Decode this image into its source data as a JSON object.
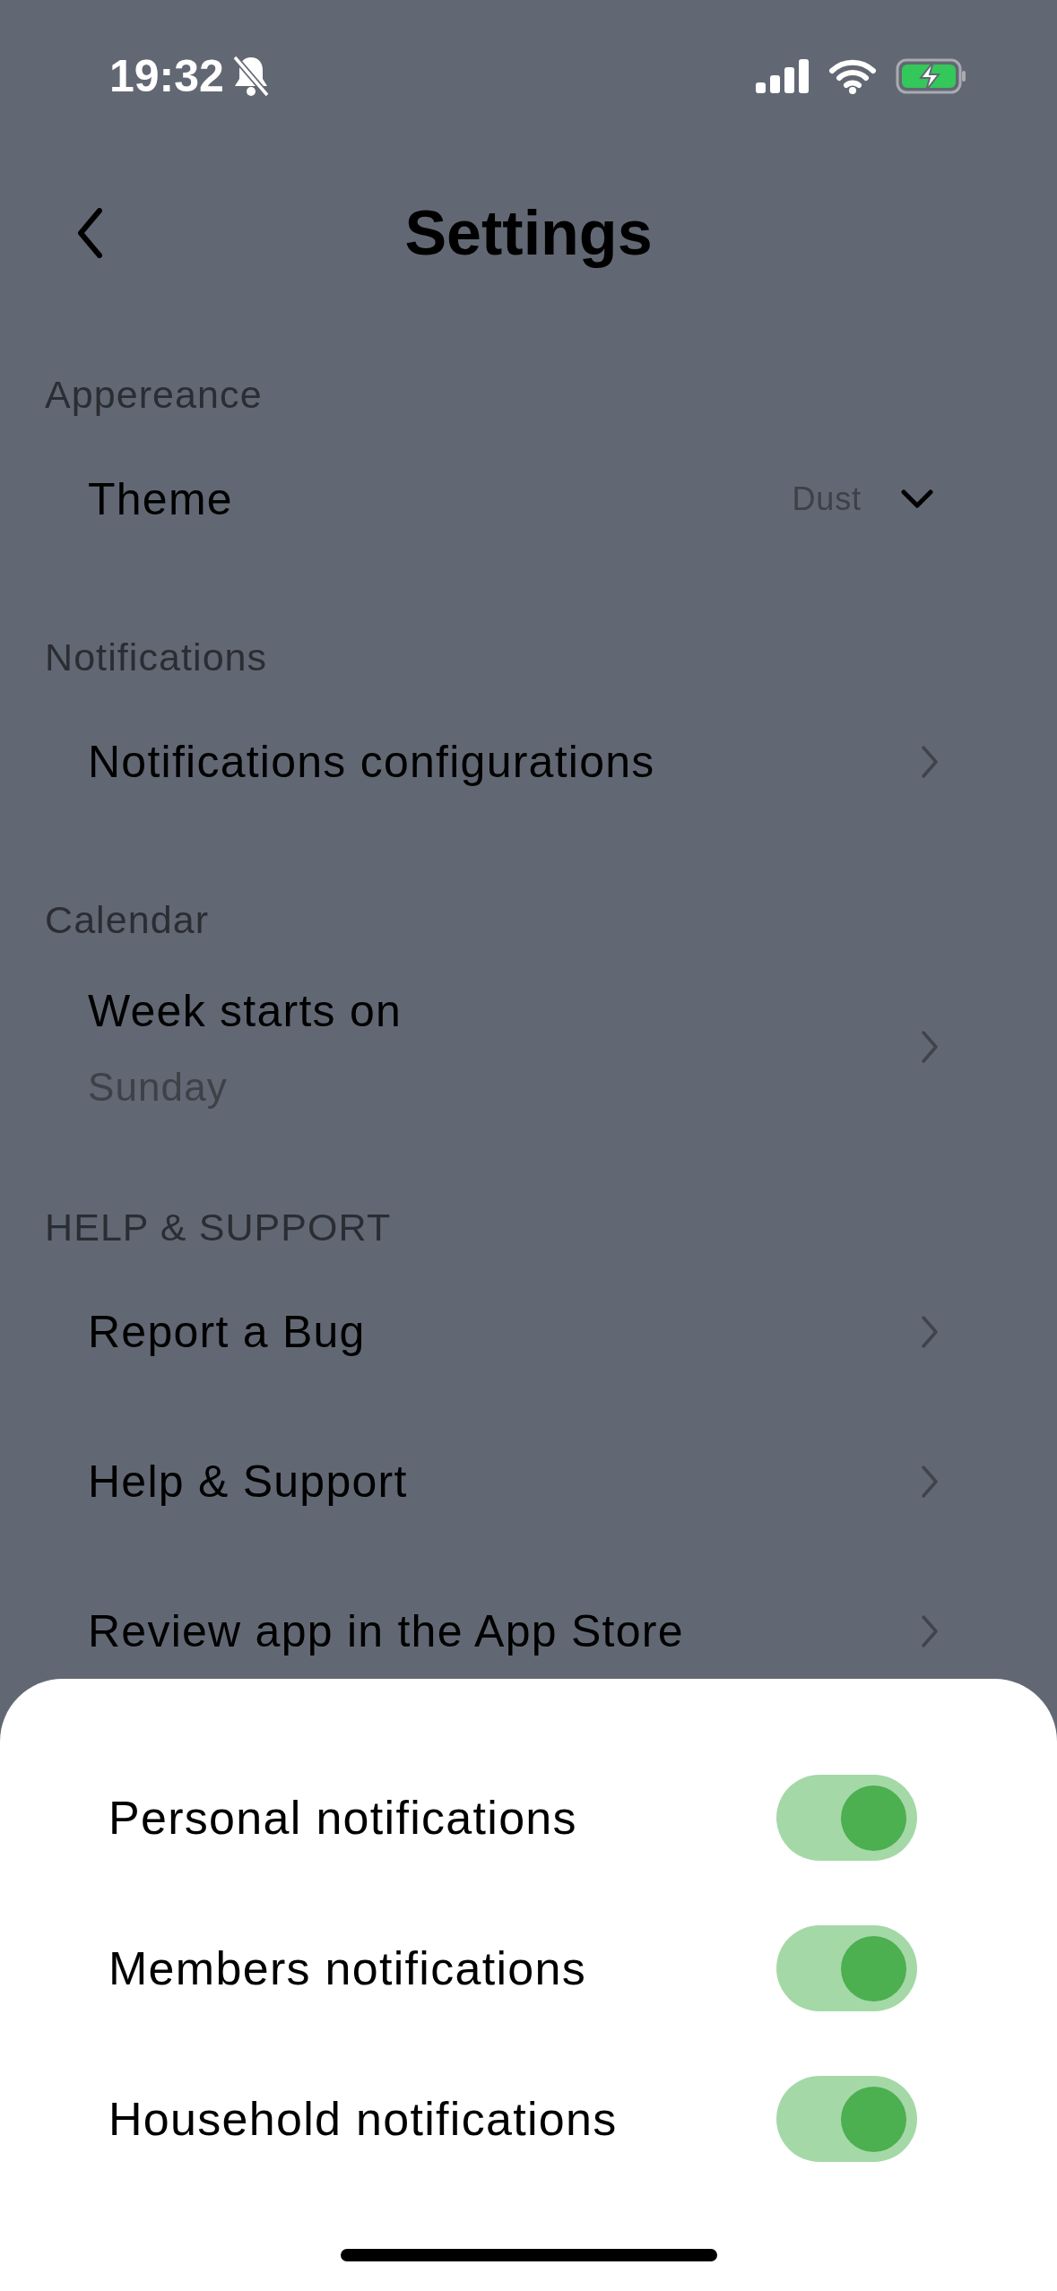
{
  "status_bar": {
    "time": "19:32"
  },
  "header": {
    "title": "Settings"
  },
  "sections": [
    {
      "title": "Appereance",
      "items": [
        {
          "kind": "dropdown",
          "label": "Theme",
          "value": "Dust"
        }
      ]
    },
    {
      "title": "Notifications",
      "items": [
        {
          "kind": "link",
          "label": "Notifications configurations"
        }
      ]
    },
    {
      "title": "Calendar",
      "items": [
        {
          "kind": "link",
          "label": "Week starts on",
          "subtitle": "Sunday"
        }
      ]
    },
    {
      "title": "HELP & SUPPORT",
      "items": [
        {
          "kind": "link",
          "label": "Report a Bug"
        },
        {
          "kind": "link",
          "label": "Help & Support"
        },
        {
          "kind": "link",
          "label": "Review app in the App Store"
        }
      ]
    }
  ],
  "sheet": {
    "toggles": [
      {
        "label": "Personal notifications",
        "on": true
      },
      {
        "label": "Members notifications",
        "on": true
      },
      {
        "label": "Household notifications",
        "on": true
      }
    ]
  }
}
